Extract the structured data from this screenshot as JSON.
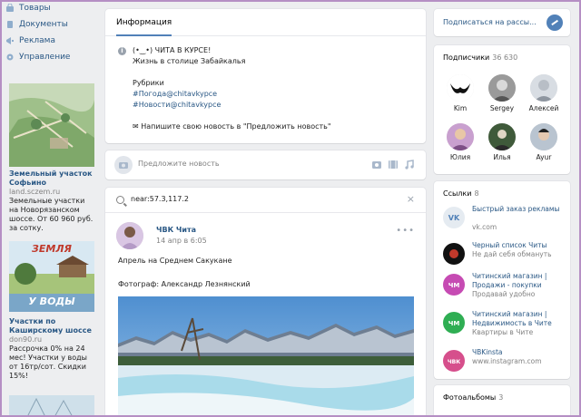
{
  "sidebar": {
    "items": [
      {
        "label": "Товары",
        "icon": "bag-icon"
      },
      {
        "label": "Документы",
        "icon": "document-icon"
      },
      {
        "label": "Реклама",
        "icon": "megaphone-icon"
      },
      {
        "label": "Управление",
        "icon": "gear-icon"
      }
    ]
  },
  "ads": [
    {
      "title": "Земельный участок Софьино",
      "domain": "land.sczem.ru",
      "desc": "Земельные участки на Новорязанском шоссе. От 60 960 руб. за сотку."
    },
    {
      "title": "Участки по Каширскому шоссе",
      "domain": "don90.ru",
      "desc": "Рассрочка 0% на 24 мес! Участки у воды от 16тр/сот. Скидки 15%!",
      "image_caption_top": "ЗЕМЛЯ",
      "image_caption_bottom": "У ВОДЫ"
    }
  ],
  "info": {
    "tab": "Информация",
    "lines": [
      "(•‿•) ЧИТА В КУРСЕ!",
      "Жизнь в столице Забайкалья",
      "Рубрики",
      "#Погода@chitavkypce",
      "#Новости@chitavkypce",
      "✉ Напишите свою новость в \"Предложить новость\""
    ]
  },
  "suggest": {
    "placeholder": "Предложите новость"
  },
  "search": {
    "value": "near:57.3,117.2"
  },
  "post": {
    "author": "ЧВК Чита",
    "date": "14 апр в 6:05",
    "text": "Апрель на Среднем Сакукане",
    "credit": "Фотограф: Александр Лезнянский"
  },
  "subscribe": {
    "label": "Подписаться на рассы..."
  },
  "subscribers": {
    "title": "Подписчики",
    "count": "36 630",
    "people": [
      {
        "name": "Kim"
      },
      {
        "name": "Sergey"
      },
      {
        "name": "Алексей"
      },
      {
        "name": "Юлия"
      },
      {
        "name": "Илья"
      },
      {
        "name": "Ayur"
      }
    ]
  },
  "links": {
    "title": "Ссылки",
    "count": "8",
    "items": [
      {
        "title": "Быстрый заказ рекламы",
        "sub": "vk.com",
        "icon": "vk-logo-icon"
      },
      {
        "title": "Черный список Читы",
        "sub": "Не дай себя обмануть",
        "icon": "blacklist-icon"
      },
      {
        "title": "Читинский магазин | Продажи - покупки",
        "sub": "Продавай удобно",
        "icon": "chm-shop-icon"
      },
      {
        "title": "Читинский магазин | Недвижимость в Чите",
        "sub": "Квартиры в Чите",
        "icon": "chm-realty-icon"
      },
      {
        "title": "ЧВKinsta",
        "sub": "www.instagram.com",
        "icon": "instagram-icon"
      }
    ]
  },
  "albums": {
    "title": "Фотоальбомы",
    "count": "3"
  },
  "colors": {
    "accent": "#5181b8",
    "link": "#2a5885",
    "bg": "#edeef0",
    "frame": "#b58fc4"
  }
}
